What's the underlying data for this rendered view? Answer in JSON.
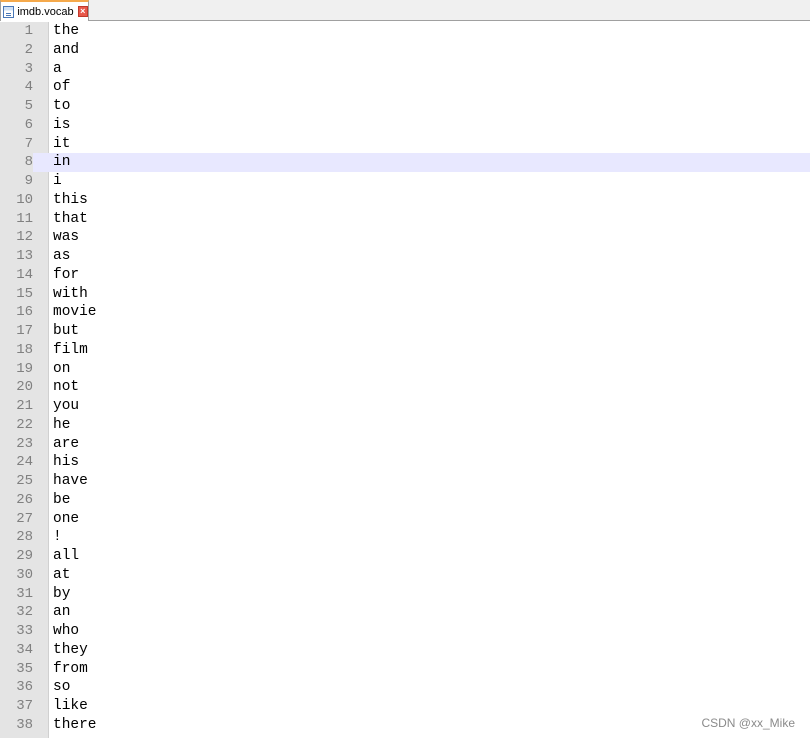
{
  "tab": {
    "icon": "file-icon",
    "label": "imdb.vocab",
    "close_icon": "close-icon",
    "close_glyph": "×"
  },
  "editor": {
    "current_line": 8,
    "lines": [
      {
        "n": "1",
        "text": "the"
      },
      {
        "n": "2",
        "text": "and"
      },
      {
        "n": "3",
        "text": "a"
      },
      {
        "n": "4",
        "text": "of"
      },
      {
        "n": "5",
        "text": "to"
      },
      {
        "n": "6",
        "text": "is"
      },
      {
        "n": "7",
        "text": "it"
      },
      {
        "n": "8",
        "text": "in"
      },
      {
        "n": "9",
        "text": "i"
      },
      {
        "n": "10",
        "text": "this"
      },
      {
        "n": "11",
        "text": "that"
      },
      {
        "n": "12",
        "text": "was"
      },
      {
        "n": "13",
        "text": "as"
      },
      {
        "n": "14",
        "text": "for"
      },
      {
        "n": "15",
        "text": "with"
      },
      {
        "n": "16",
        "text": "movie"
      },
      {
        "n": "17",
        "text": "but"
      },
      {
        "n": "18",
        "text": "film"
      },
      {
        "n": "19",
        "text": "on"
      },
      {
        "n": "20",
        "text": "not"
      },
      {
        "n": "21",
        "text": "you"
      },
      {
        "n": "22",
        "text": "he"
      },
      {
        "n": "23",
        "text": "are"
      },
      {
        "n": "24",
        "text": "his"
      },
      {
        "n": "25",
        "text": "have"
      },
      {
        "n": "26",
        "text": "be"
      },
      {
        "n": "27",
        "text": "one"
      },
      {
        "n": "28",
        "text": "!"
      },
      {
        "n": "29",
        "text": "all"
      },
      {
        "n": "30",
        "text": "at"
      },
      {
        "n": "31",
        "text": "by"
      },
      {
        "n": "32",
        "text": "an"
      },
      {
        "n": "33",
        "text": "who"
      },
      {
        "n": "34",
        "text": "they"
      },
      {
        "n": "35",
        "text": "from"
      },
      {
        "n": "36",
        "text": "so"
      },
      {
        "n": "37",
        "text": "like"
      },
      {
        "n": "38",
        "text": "there"
      }
    ]
  },
  "watermark": "CSDN @xx_Mike",
  "colors": {
    "current_line_bg": "#e8e8ff",
    "gutter_bg": "#e4e4e4",
    "line_number": "#808080",
    "tab_accent": "#f5a94b",
    "close_icon": "#e8584a"
  }
}
